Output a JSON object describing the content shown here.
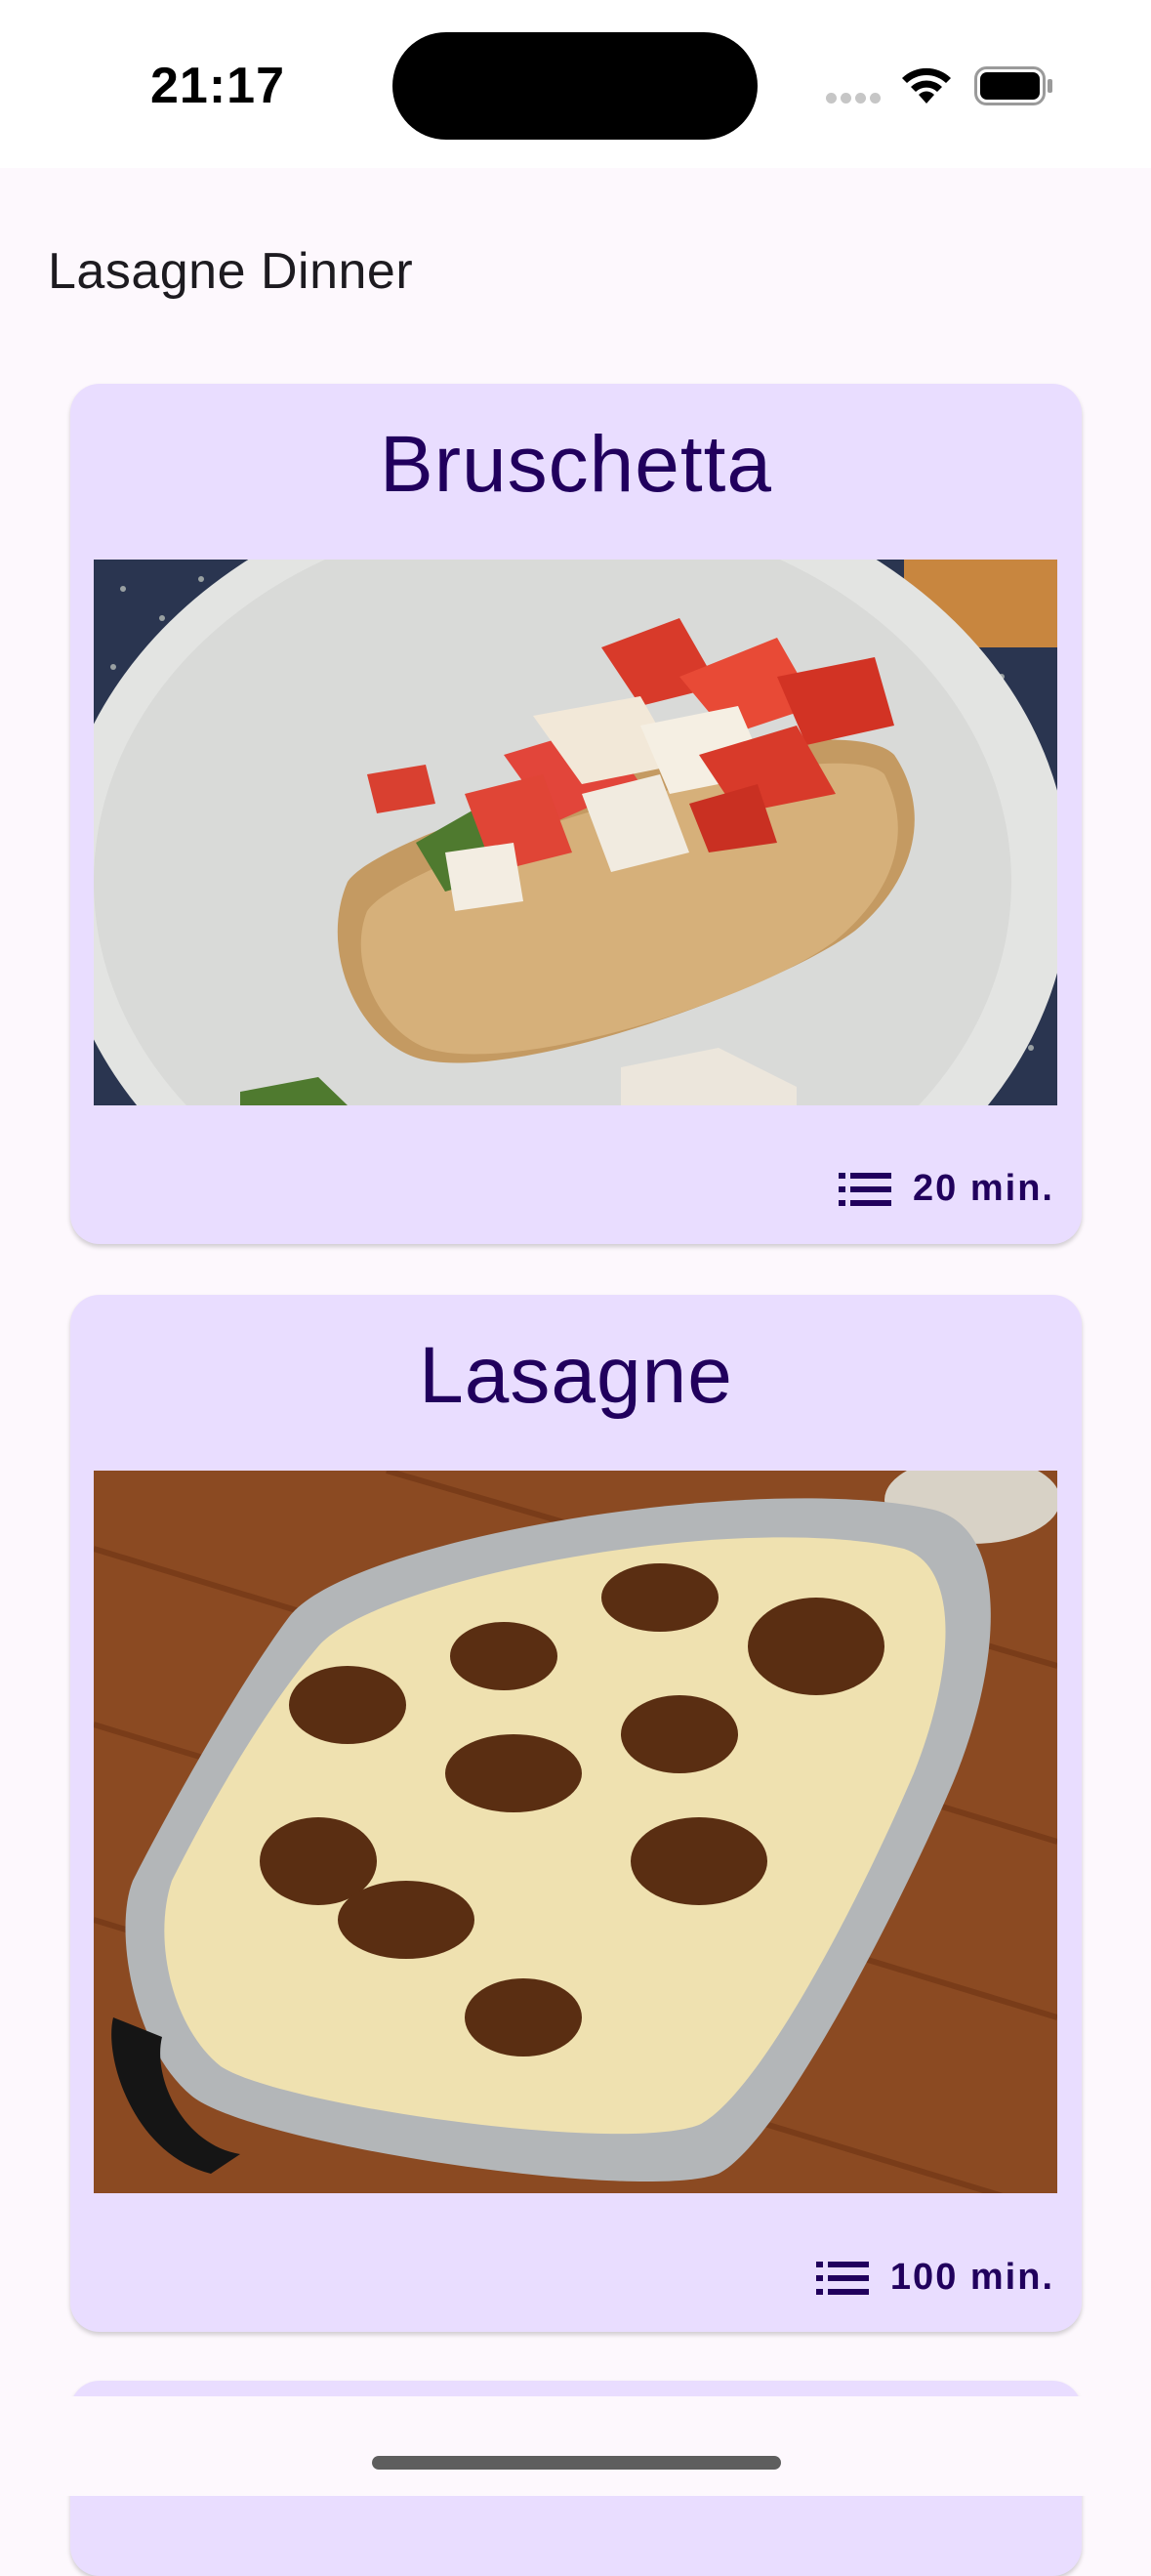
{
  "status_bar": {
    "time": "21:17",
    "icons": [
      "cellular-signal-icon",
      "wifi-icon",
      "battery-icon"
    ]
  },
  "app_bar": {
    "title": "Lasagne Dinner"
  },
  "recipes": [
    {
      "title": "Bruschetta",
      "image": "bruschetta-photo",
      "icon": "list-icon",
      "duration": "20 min."
    },
    {
      "title": "Lasagne",
      "image": "lasagne-photo",
      "icon": "list-icon",
      "duration": "100 min."
    }
  ],
  "colors": {
    "background": "#fdf8fd",
    "card": "#e9ddff",
    "card_text": "#21005d"
  }
}
